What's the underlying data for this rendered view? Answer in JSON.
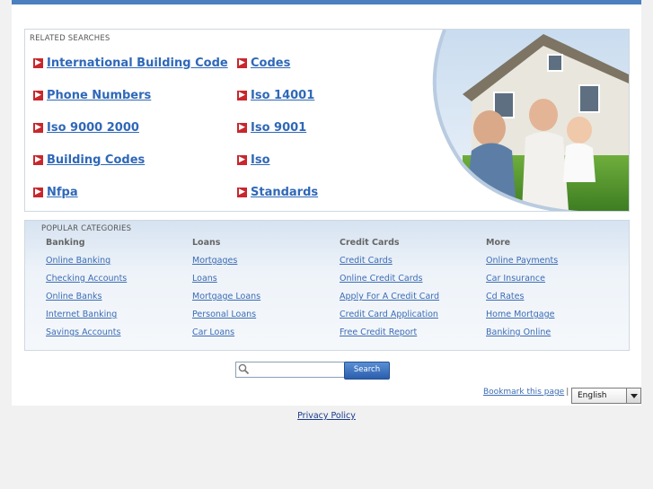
{
  "related": {
    "title": "RELATED SEARCHES",
    "links": [
      {
        "label": "International Building Code"
      },
      {
        "label": "Codes"
      },
      {
        "label": "Phone Numbers"
      },
      {
        "label": "Iso 14001"
      },
      {
        "label": "Iso 9000 2000"
      },
      {
        "label": "Iso 9001"
      },
      {
        "label": "Building Codes"
      },
      {
        "label": "Iso"
      },
      {
        "label": "Nfpa"
      },
      {
        "label": "Standards"
      }
    ]
  },
  "popular": {
    "title": "POPULAR CATEGORIES",
    "columns": [
      {
        "heading": "Banking",
        "links": [
          "Online Banking",
          "Checking Accounts",
          "Online Banks",
          "Internet Banking",
          "Savings Accounts"
        ]
      },
      {
        "heading": "Loans",
        "links": [
          "Mortgages",
          "Loans",
          "Mortgage Loans",
          "Personal Loans",
          "Car Loans"
        ]
      },
      {
        "heading": "Credit Cards",
        "links": [
          "Credit Cards",
          "Online Credit Cards",
          "Apply For A Credit Card",
          "Credit Card Application",
          "Free Credit Report"
        ]
      },
      {
        "heading": "More",
        "links": [
          "Online Payments",
          "Car Insurance",
          "Cd Rates",
          "Home Mortgage",
          "Banking Online"
        ]
      }
    ]
  },
  "search": {
    "placeholder": "",
    "button": "Search"
  },
  "footer": {
    "bookmark": "Bookmark this page",
    "separator": "|",
    "language": "English",
    "privacy": "Privacy Policy"
  },
  "colors": {
    "accent": "#4a7fc0",
    "link": "#2f68b8",
    "bullet": "#c8272d"
  },
  "icons": {
    "bullet": "arrow-right-icon",
    "search": "magnifier-icon",
    "dropdown": "chevron-down-icon"
  }
}
